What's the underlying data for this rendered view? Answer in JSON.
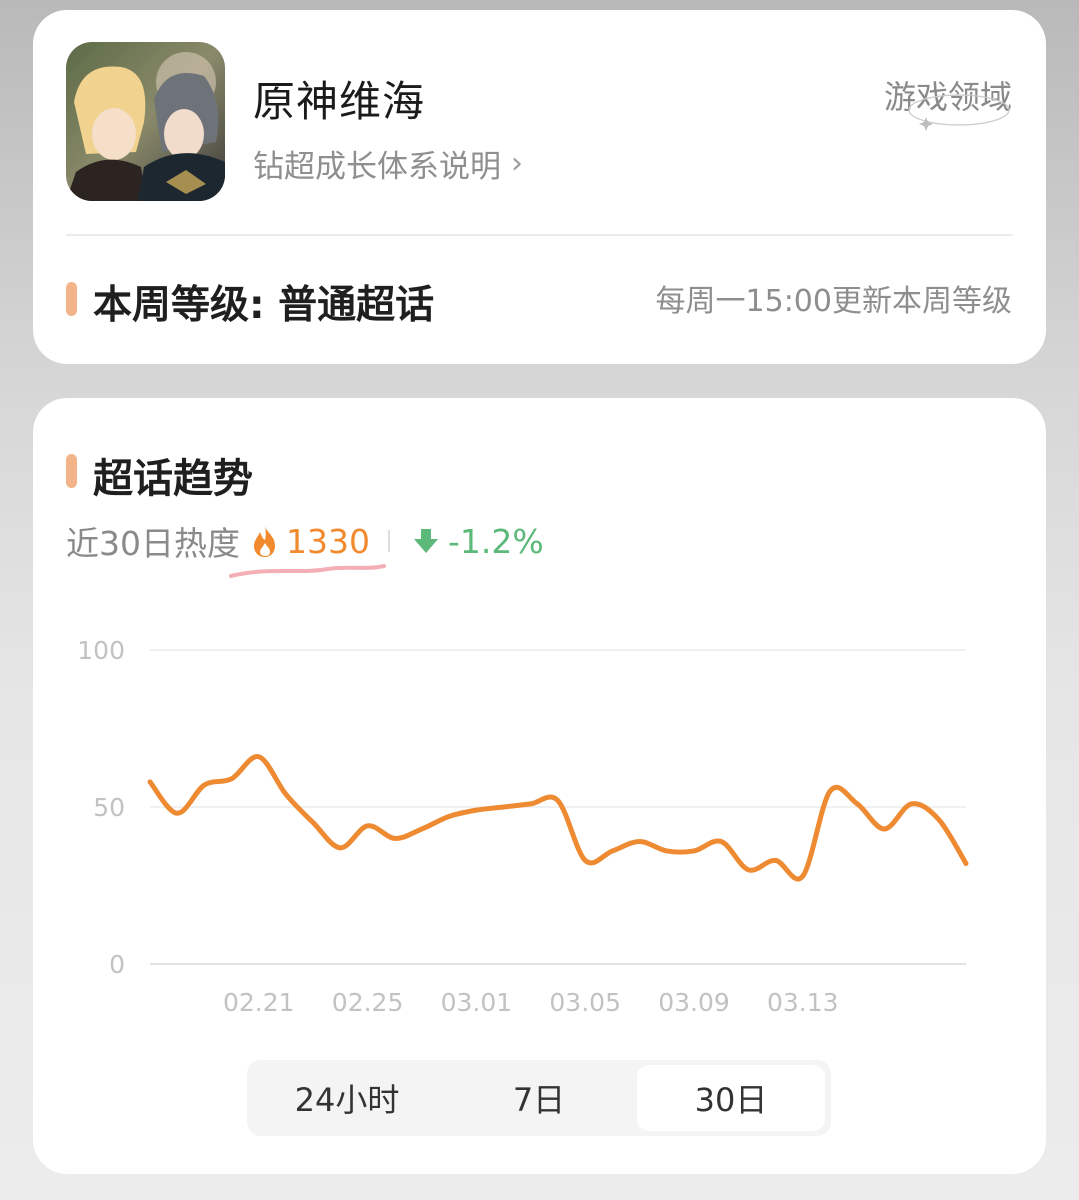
{
  "community": {
    "name": "原神维海",
    "growth_link": "钻超成长体系说明",
    "domain_badge": "游戏领域",
    "level_text": "本周等级: 普通超话",
    "level_update": "每周一15:00更新本周等级"
  },
  "trend": {
    "title": "超话趋势",
    "heat_label": "近30日热度",
    "heat_value": "1330",
    "change": "-1.2%",
    "icons": {
      "heat": "fire-icon",
      "change": "arrow-down-icon"
    },
    "colors": {
      "accent": "#f3b48a",
      "heat": "#f08a2d",
      "down": "#5cb97a",
      "line": "#ee8a32"
    }
  },
  "tabs": [
    {
      "label": "24小时",
      "active": false
    },
    {
      "label": "7日",
      "active": false
    },
    {
      "label": "30日",
      "active": true
    }
  ],
  "chart_data": {
    "type": "line",
    "yticks": [
      "100",
      "50",
      "0"
    ],
    "ylim": [
      0,
      100
    ],
    "xticks": [
      "02.21",
      "02.25",
      "03.01",
      "03.05",
      "03.09",
      "03.13"
    ],
    "series": [
      {
        "values": [
          58,
          48,
          57,
          59,
          66,
          54,
          45,
          37,
          44,
          40,
          43,
          47,
          49,
          50,
          51,
          52,
          33,
          36,
          39,
          36,
          36,
          39,
          30,
          33,
          28,
          55,
          51,
          43,
          51,
          46,
          32
        ]
      }
    ],
    "grid": true,
    "legend": "none"
  }
}
